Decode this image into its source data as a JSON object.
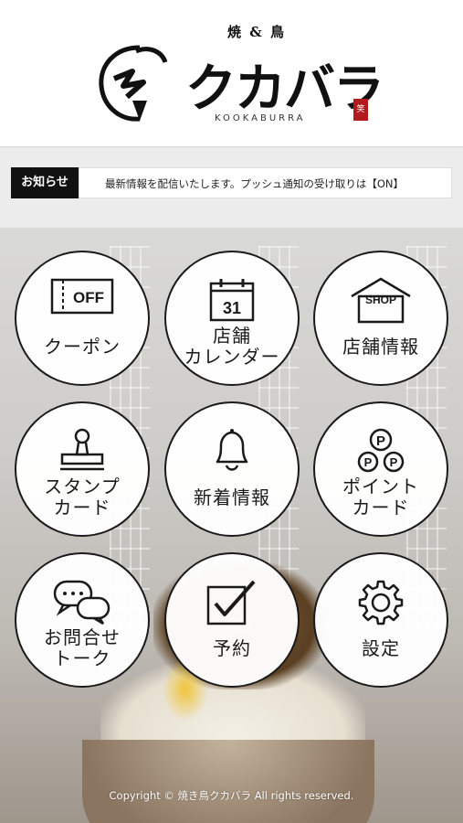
{
  "header": {
    "logo_sub": "焼 & 鳥",
    "logo_main": "クカバラ",
    "logo_en": "KOOKABURRA",
    "seal": "笑"
  },
  "news": {
    "label": "お知らせ",
    "text": "最新情報を配信いたします。プッシュ通知の受け取りは【ON】"
  },
  "menu": [
    {
      "line1": "クーポン",
      "icon": "coupon-off-icon",
      "icon_text": "OFF"
    },
    {
      "line1": "店舗",
      "line2": "カレンダー",
      "icon": "calendar-icon",
      "icon_text": "31"
    },
    {
      "line1": "店舗情報",
      "icon": "shop-icon",
      "icon_text": "SHOP"
    },
    {
      "line1": "スタンプ",
      "line2": "カード",
      "icon": "stamp-icon"
    },
    {
      "line1": "新着情報",
      "icon": "bell-icon"
    },
    {
      "line1": "ポイント",
      "line2": "カード",
      "icon": "point-coins-icon",
      "icon_text": "P"
    },
    {
      "line1": "お問合せ",
      "line2": "トーク",
      "icon": "chat-icon"
    },
    {
      "line1": "予約",
      "icon": "checkbox-icon"
    },
    {
      "line1": "設定",
      "icon": "gear-icon"
    }
  ],
  "footer": {
    "copyright": "Copyright © 焼き鳥クカバラ All rights reserved."
  }
}
